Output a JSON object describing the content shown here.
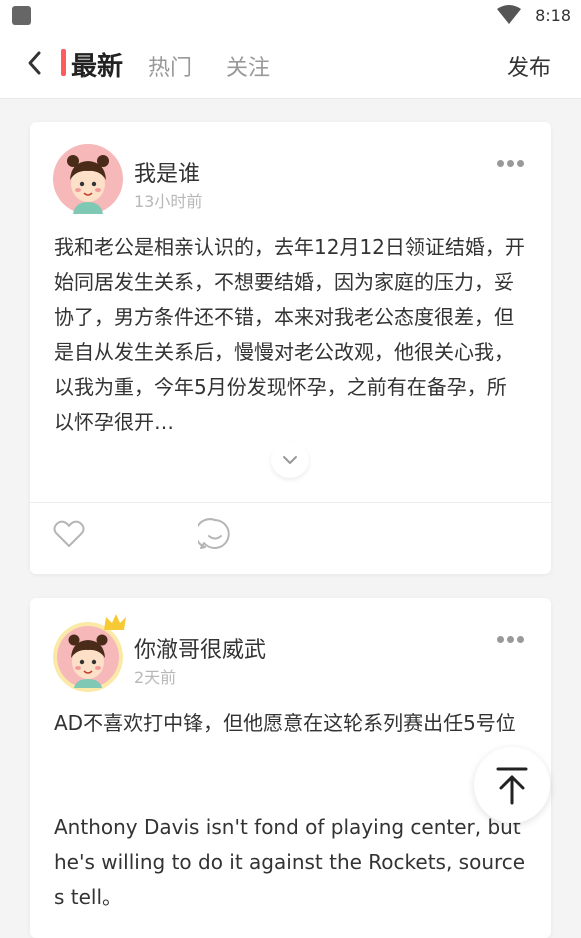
{
  "status_bar": {
    "time": "8:18"
  },
  "nav": {
    "tabs": [
      {
        "label": "最新",
        "active": true
      },
      {
        "label": "热门",
        "active": false
      },
      {
        "label": "关注",
        "active": false
      }
    ],
    "publish_label": "发布"
  },
  "posts": [
    {
      "username": "我是谁",
      "time": "13小时前",
      "content": "我和老公是相亲认识的，去年12月12日领证结婚，开始同居发生关系，不想要结婚，因为家庭的压力，妥协了，男方条件还不错，本来对我老公态度很差，但是自从发生关系后，慢慢对老公改观，他很关心我，以我为重，今年5月份发现怀孕，之前有在备孕，所以怀孕很开…"
    },
    {
      "username": "你澈哥很威武",
      "time": "2天前",
      "content_zh": "AD不喜欢打中锋，但他愿意在这轮系列赛出任5号位",
      "content_en": "Anthony Davis isn't fond of playing center, but he's willing to do it against the Rockets, sources tell。"
    }
  ],
  "colors": {
    "accent": "#ff5a5f",
    "muted": "#999999",
    "background": "#f4f4f4"
  },
  "icons": [
    "wifi-icon",
    "back-arrow-icon",
    "more-dots-icon",
    "chevron-down-icon",
    "heart-icon",
    "comment-icon",
    "crown-icon",
    "scroll-to-top-icon"
  ]
}
